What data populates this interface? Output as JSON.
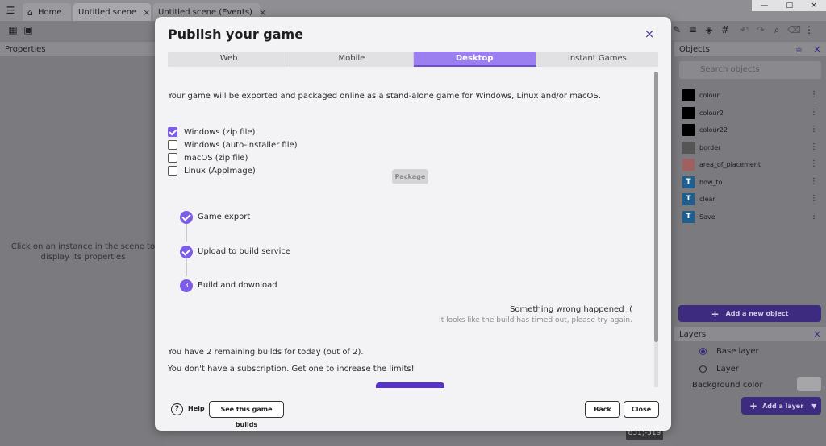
{
  "app": {
    "tabs": [
      {
        "label": "Home"
      },
      {
        "label": "Untitled scene"
      },
      {
        "label": "Untitled scene (Events)"
      }
    ],
    "close_glyph": "×"
  },
  "properties_panel": {
    "title": "Properties",
    "hint": "Click on an instance in the scene to display its properties"
  },
  "objects_panel": {
    "title": "Objects",
    "search_placeholder": "Search objects",
    "items": [
      {
        "name": "colour",
        "thumb_color": "#000000",
        "icon": "color-square-icon"
      },
      {
        "name": "colour2",
        "thumb_color": "#000000",
        "icon": "color-square-icon"
      },
      {
        "name": "colour22",
        "thumb_color": "#000000",
        "icon": "color-square-icon"
      },
      {
        "name": "border",
        "thumb_color": "#555555",
        "icon": "color-square-icon"
      },
      {
        "name": "area_of_placement",
        "thumb_color": "#a06060",
        "icon": "color-square-icon"
      },
      {
        "name": "how_to",
        "thumb_color": "#1f5f8f",
        "icon": "text-object-icon"
      },
      {
        "name": "clear",
        "thumb_color": "#1f5f8f",
        "icon": "text-object-icon"
      },
      {
        "name": "Save",
        "thumb_color": "#1f5f8f",
        "icon": "text-object-icon"
      }
    ],
    "add_button": "Add a new object"
  },
  "layers_panel": {
    "title": "Layers",
    "layers": [
      {
        "name": "Base layer",
        "selected": true
      },
      {
        "name": "Layer",
        "selected": false
      }
    ],
    "background_color_label": "Background color",
    "add_button": "Add a layer"
  },
  "coords_readout": "831;-319",
  "dialog": {
    "title": "Publish your game",
    "tabs": [
      {
        "label": "Web",
        "active": false
      },
      {
        "label": "Mobile",
        "active": false
      },
      {
        "label": "Desktop",
        "active": true
      },
      {
        "label": "Instant Games",
        "active": false
      }
    ],
    "intro": "Your game will be exported and packaged online as a stand-alone game for Windows, Linux and/or macOS.",
    "targets": [
      {
        "label": "Windows (zip file)",
        "checked": true
      },
      {
        "label": "Windows (auto-installer file)",
        "checked": false
      },
      {
        "label": "macOS (zip file)",
        "checked": false
      },
      {
        "label": "Linux (AppImage)",
        "checked": false
      }
    ],
    "package_button": "Package",
    "steps": [
      {
        "label": "Game export",
        "status": "done",
        "marker": ""
      },
      {
        "label": "Upload to build service",
        "status": "done",
        "marker": ""
      },
      {
        "label": "Build and download",
        "status": "current",
        "marker": "3"
      }
    ],
    "error_title": "Something wrong happened :(",
    "error_desc": "It looks like the build has timed out, please try again.",
    "remaining_builds": "You have 2 remaining builds for today (out of 2).",
    "subscription_note": "You don't have a subscription. Get one to increase the limits!",
    "footer": {
      "help_label": "Help",
      "help_glyph": "?",
      "see_builds_button": "See this game builds",
      "back_button": "Back",
      "close_button": "Close"
    },
    "accent_color": "#7d5ce8"
  }
}
